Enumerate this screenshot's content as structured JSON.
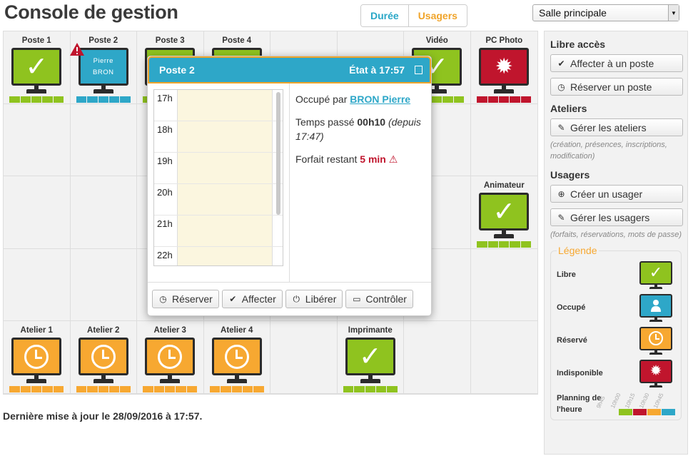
{
  "header": {
    "title": "Console de gestion",
    "toggle": [
      "Durée",
      "Usagers"
    ],
    "room": "Salle principale"
  },
  "colors": {
    "libre": "#8fc31f",
    "occupe": "#2ea7c8",
    "reserve": "#f7a831",
    "indisponible": "#c0152d"
  },
  "stations_row1": [
    {
      "name": "Poste 1",
      "state": "libre"
    },
    {
      "name": "Poste 2",
      "state": "occupe",
      "screen_text": [
        "Pierre",
        "BRON"
      ],
      "warning": true
    },
    {
      "name": "Poste 3",
      "state": "libre"
    },
    {
      "name": "Poste 4",
      "state": "libre"
    },
    {
      "name": "",
      "state": "empty"
    },
    {
      "name": "",
      "state": "empty"
    },
    {
      "name": "Vidéo",
      "state": "libre"
    },
    {
      "name": "PC Photo",
      "state": "indisponible"
    }
  ],
  "animateur": {
    "name": "Animateur",
    "state": "libre"
  },
  "stations_row5": [
    {
      "name": "Atelier 1",
      "state": "reserve"
    },
    {
      "name": "Atelier 2",
      "state": "reserve"
    },
    {
      "name": "Atelier 3",
      "state": "reserve"
    },
    {
      "name": "Atelier 4",
      "state": "reserve"
    },
    {
      "name": "",
      "state": "empty"
    },
    {
      "name": "Imprimante",
      "state": "libre"
    },
    {
      "name": "",
      "state": "empty"
    },
    {
      "name": "",
      "state": "empty"
    }
  ],
  "popup": {
    "title": "Poste 2",
    "state_label": "État à 17:57",
    "hours": [
      "17h",
      "18h",
      "19h",
      "20h",
      "21h",
      "22h"
    ],
    "occupied_prefix": "Occupé par",
    "occupied_user": "BRON Pierre",
    "time_prefix": "Temps passé",
    "time_value": "00h10",
    "time_since": "(depuis 17:47)",
    "forfait_prefix": "Forfait restant",
    "forfait_value": "5 min",
    "buttons": [
      "Réserver",
      "Affecter",
      "Libérer",
      "Contrôler"
    ]
  },
  "footer": {
    "updated": "Dernière mise à jour le 28/09/2016 à 17:57."
  },
  "sidebar": {
    "libre_title": "Libre accès",
    "affecter": "Affecter à un poste",
    "reserver": "Réserver un poste",
    "ateliers_title": "Ateliers",
    "gerer_ateliers": "Gérer les ateliers",
    "ateliers_note": "(création, présences, inscriptions, modification)",
    "usagers_title": "Usagers",
    "creer_usager": "Créer un usager",
    "gerer_usagers": "Gérer les usagers",
    "usagers_note": "(forfaits, réservations, mots de passe)",
    "legend_title": "Légende",
    "legend": [
      "Libre",
      "Occupé",
      "Réservé",
      "Indisponible"
    ],
    "planning_label": "Planning de l'heure",
    "planning_ticks": [
      "9h45",
      "10h00",
      "10h15",
      "10h30",
      "10h45"
    ]
  }
}
